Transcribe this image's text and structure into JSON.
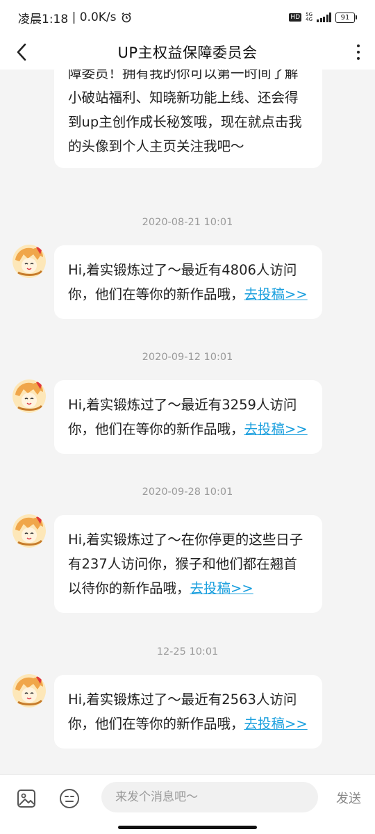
{
  "status_bar": {
    "time": "凌晨1:18",
    "separator": " | ",
    "speed": "0.0K/s",
    "hd": "HD",
    "network": "5G",
    "network_sub": "4G",
    "battery": "91"
  },
  "header": {
    "title": "UP主权益保障委员会"
  },
  "messages": [
    {
      "text": "障委员！拥有我的你可以第一时间了解小破站福利、知晓新功能上线、还会得到up主创作成长秘笈哦，现在就点击我的头像到个人主页关注我吧～",
      "link": ""
    },
    {
      "timestamp": "2020-08-21 10:01",
      "text": "Hi,着实锻炼过了～最近有4806人访问你，他们在等你的新作品哦，",
      "link": "去投稿>>"
    },
    {
      "timestamp": "2020-09-12 10:01",
      "text": "Hi,着实锻炼过了～最近有3259人访问你，他们在等你的新作品哦，",
      "link": "去投稿>>"
    },
    {
      "timestamp": "2020-09-28 10:01",
      "text": "Hi,着实锻炼过了～在你停更的这些日子有237人访问你，猴子和他们都在翘首以待你的新作品哦，",
      "link": "去投稿>>"
    },
    {
      "timestamp": "12-25 10:01",
      "text": "Hi,着实锻炼过了～最近有2563人访问你，他们在等你的新作品哦，",
      "link": "去投稿>>"
    }
  ],
  "input": {
    "placeholder": "来发个消息吧～",
    "send_label": "发送"
  },
  "icons": {
    "back": "back-arrow-icon",
    "more": "more-vertical-icon",
    "image": "image-icon",
    "emoji": "emoji-icon",
    "alarm": "alarm-clock-icon"
  },
  "colors": {
    "link": "#1a9fde",
    "background": "#f4f4f4",
    "bubble": "#ffffff"
  }
}
